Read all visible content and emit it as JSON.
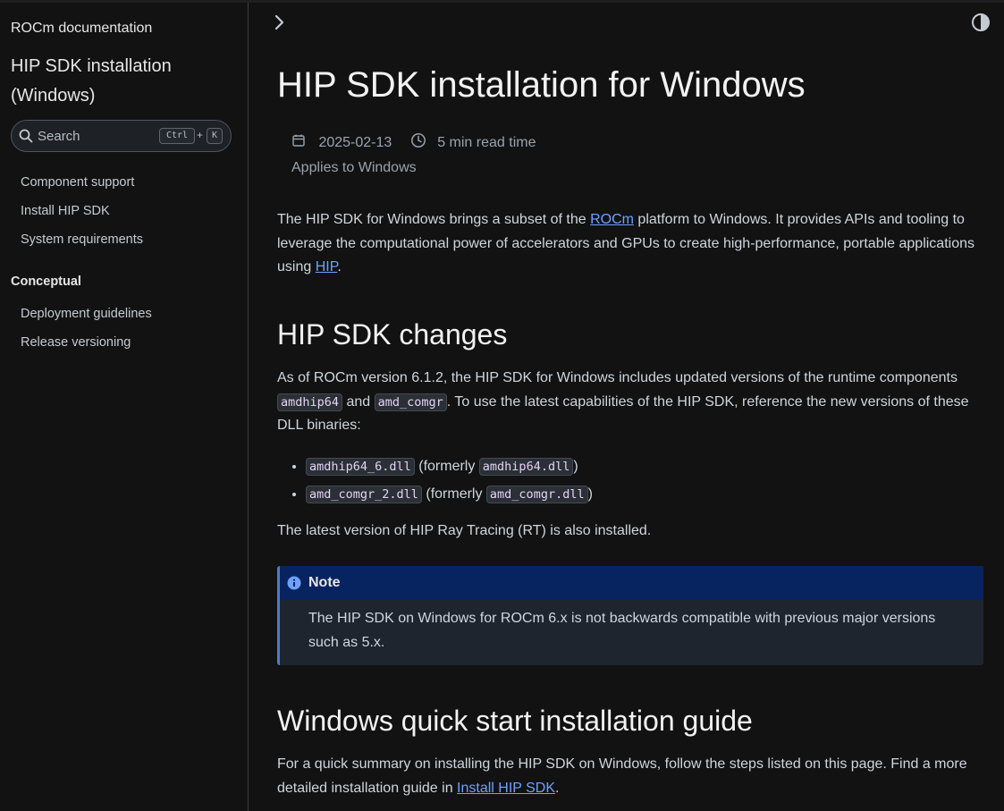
{
  "sidebar": {
    "brand": "ROCm documentation",
    "page_name": "HIP SDK installation (Windows)",
    "search": {
      "placeholder": "Search",
      "key1": "Ctrl",
      "plus": "+",
      "key2": "K"
    },
    "items": [
      {
        "label": "Component support"
      },
      {
        "label": "Install HIP SDK"
      },
      {
        "label": "System requirements"
      }
    ],
    "caption": "Conceptual",
    "items2": [
      {
        "label": "Deployment guidelines"
      },
      {
        "label": "Release versioning"
      }
    ]
  },
  "icons": {
    "toggle": "chevron-right-icon",
    "theme": "contrast-icon",
    "date": "calendar-icon",
    "time": "clock-icon",
    "note": "info-icon"
  },
  "main": {
    "title": "HIP SDK installation for Windows",
    "date": "2025-02-13",
    "read_time": "5 min read time",
    "applies": "Applies to Windows",
    "intro": {
      "pre": "The HIP SDK for Windows brings a subset of the ",
      "link1": "ROCm",
      "mid": " platform to Windows. It provides APIs and tooling to leverage the computational power of accelerators and GPUs to create high-performance, portable applications using ",
      "link2": "HIP",
      "post": "."
    },
    "h2_changes": "HIP SDK changes",
    "changes": {
      "pre": "As of ROCm version 6.1.2, the HIP SDK for Windows includes updated versions of the runtime components ",
      "code1": "amdhip64",
      "and": " and ",
      "code2": "amd_comgr",
      "post": ". To use the latest capabilities of the HIP SDK, reference the new versions of these DLL binaries:"
    },
    "bullets": [
      {
        "new": "amdhip64_6.dll",
        "formerly": " (formerly ",
        "old": "amdhip64.dll",
        "close": ")"
      },
      {
        "new": "amd_comgr_2.dll",
        "formerly": " (formerly ",
        "old": "amd_comgr.dll",
        "close": ")"
      }
    ],
    "rt_text": "The latest version of HIP Ray Tracing (RT) is also installed.",
    "note": {
      "title": "Note",
      "body": "The HIP SDK on Windows for ROCm 6.x is not backwards compatible with previous major versions such as 5.x."
    },
    "h2_quick": "Windows quick start installation guide",
    "quick": {
      "pre": "For a quick summary on installing the HIP SDK on Windows, follow the steps listed on this page. Find a more detailed installation guide in ",
      "link": "Install HIP SDK",
      "post": "."
    }
  }
}
